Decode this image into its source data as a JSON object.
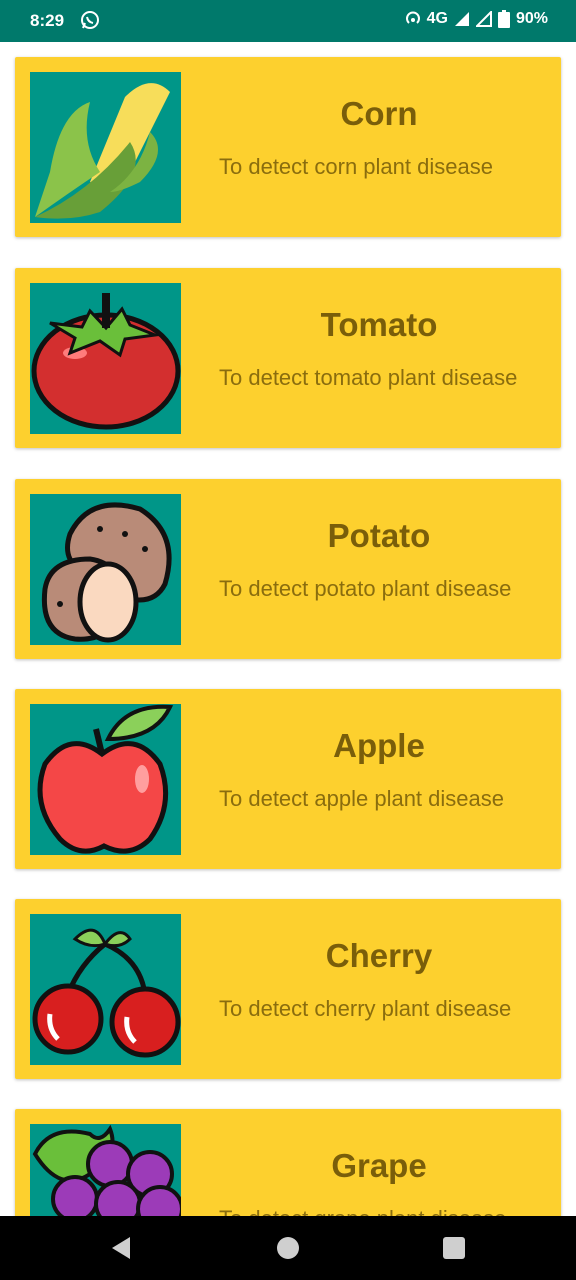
{
  "status_bar": {
    "time": "8:29",
    "network": "4G",
    "battery": "90%"
  },
  "crops": [
    {
      "title": "Corn",
      "description": "To detect corn plant disease",
      "image": "corn-icon"
    },
    {
      "title": "Tomato",
      "description": "To detect tomato plant disease",
      "image": "tomato-icon"
    },
    {
      "title": "Potato",
      "description": "To detect potato plant disease",
      "image": "potato-icon"
    },
    {
      "title": "Apple",
      "description": "To detect apple plant disease",
      "image": "apple-icon"
    },
    {
      "title": "Cherry",
      "description": "To detect cherry plant disease",
      "image": "cherry-icon"
    },
    {
      "title": "Grape",
      "description": "To detect grape plant disease",
      "image": "grape-icon"
    }
  ],
  "colors": {
    "status_bar": "#00796b",
    "card": "#fdd02e",
    "thumb_bg": "#009688",
    "title_text": "#7a5e0a"
  }
}
